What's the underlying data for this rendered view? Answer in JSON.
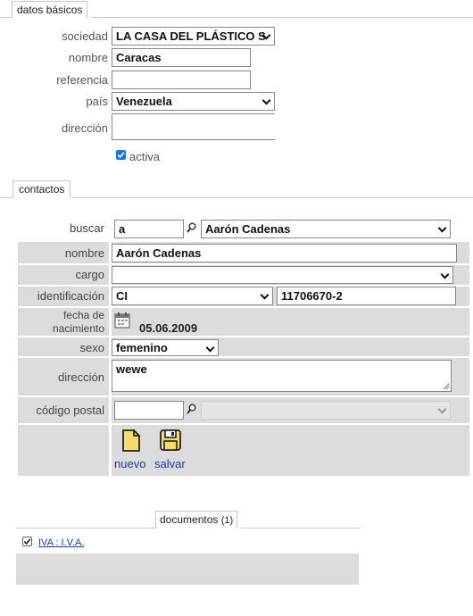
{
  "basic_tab": {
    "label": "datos básicos"
  },
  "basic": {
    "sociedad": {
      "label": "sociedad",
      "value": "LA CASA DEL PLÁSTICO S"
    },
    "nombre": {
      "label": "nombre",
      "value": "Caracas"
    },
    "referencia": {
      "label": "referencia",
      "value": ""
    },
    "pais": {
      "label": "país",
      "value": "Venezuela"
    },
    "direccion": {
      "label": "dirección",
      "value": ""
    },
    "activa": {
      "label": "activa",
      "checked": true
    }
  },
  "contacts_tab": {
    "label": "contactos"
  },
  "contacts": {
    "buscar": {
      "label": "buscar",
      "query": "a",
      "result": "Aarón Cadenas"
    },
    "nombre": {
      "label": "nombre",
      "value": "Aarón Cadenas"
    },
    "cargo": {
      "label": "cargo",
      "value": ""
    },
    "identificacion": {
      "label": "identificación",
      "type": "CI",
      "number": "11706670-2"
    },
    "fecha": {
      "label_line1": "fecha de",
      "label_line2": "nacimiento",
      "value": "05.06.2009"
    },
    "sexo": {
      "label": "sexo",
      "value": "femenino"
    },
    "direccion": {
      "label": "dirección",
      "value": "wewe"
    },
    "codigo_postal": {
      "label": "código postal",
      "value": "",
      "result": ""
    },
    "actions": {
      "new_label": "nuevo",
      "save_label": "salvar"
    }
  },
  "documents_tab": {
    "label": "documentos",
    "count": "(1)"
  },
  "documents": {
    "items": [
      {
        "label": "IVA : I.V.A.",
        "checked": true
      }
    ]
  },
  "colors": {
    "accent_blue": "#1a73e8",
    "link_blue": "#1a3cb0",
    "row_gray": "#dcdcdc",
    "icon_yellow": "#f4dc6b"
  },
  "icons": {
    "search": "magnifier-icon",
    "calendar": "calendar-icon",
    "new": "new-document-icon",
    "save": "floppy-disk-icon"
  }
}
